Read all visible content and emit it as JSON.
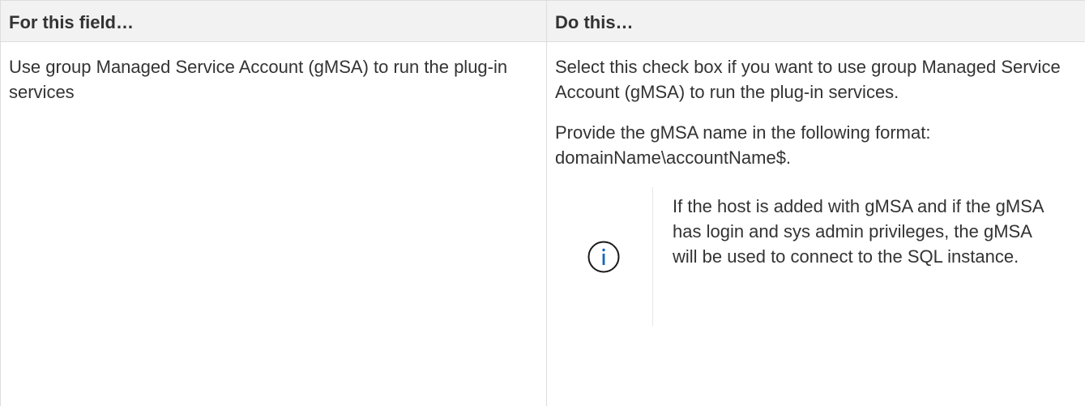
{
  "table": {
    "headers": {
      "field": "For this field…",
      "action": "Do this…"
    },
    "row": {
      "field": "Use group Managed Service Account (gMSA) to run the plug-in services",
      "action_paragraph_1": "Select this check box if you want to use group Managed Service Account (gMSA) to run the plug-in services.",
      "action_paragraph_2": "Provide the gMSA name in the following format: domainName\\accountName$.",
      "note": {
        "icon": "info-icon",
        "text": "If the host is added with gMSA and if the gMSA has login and sys admin privileges, the gMSA will be used to connect to the SQL instance."
      }
    }
  },
  "colors": {
    "header_background": "#f2f2f2",
    "border": "#dddddd",
    "text": "#333333",
    "info_icon": "#1565c0"
  }
}
